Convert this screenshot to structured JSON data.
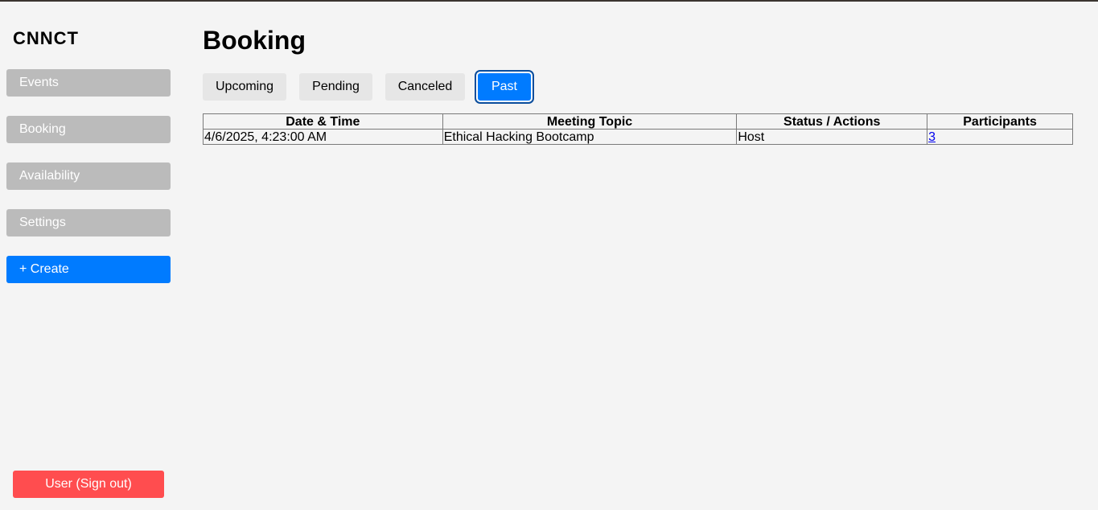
{
  "app": {
    "brand": "CNNCT"
  },
  "sidebar": {
    "items": [
      {
        "label": "Events"
      },
      {
        "label": "Booking"
      },
      {
        "label": "Availability"
      },
      {
        "label": "Settings"
      }
    ],
    "create_label": "+ Create",
    "signout_label": "User (Sign out)"
  },
  "main": {
    "title": "Booking",
    "tabs": [
      {
        "label": "Upcoming",
        "active": false
      },
      {
        "label": "Pending",
        "active": false
      },
      {
        "label": "Canceled",
        "active": false
      },
      {
        "label": "Past",
        "active": true
      }
    ],
    "table": {
      "headers": [
        "Date & Time",
        "Meeting Topic",
        "Status / Actions",
        "Participants"
      ],
      "rows": [
        [
          "4/6/2025, 4:23:00 AM",
          "Ethical Hacking Bootcamp",
          "Host",
          "3"
        ]
      ]
    }
  },
  "colors": {
    "accent": "#007bff",
    "nav_bg": "#bbbbbb",
    "signout": "#ff4d4f",
    "background": "#f4f4f4"
  }
}
